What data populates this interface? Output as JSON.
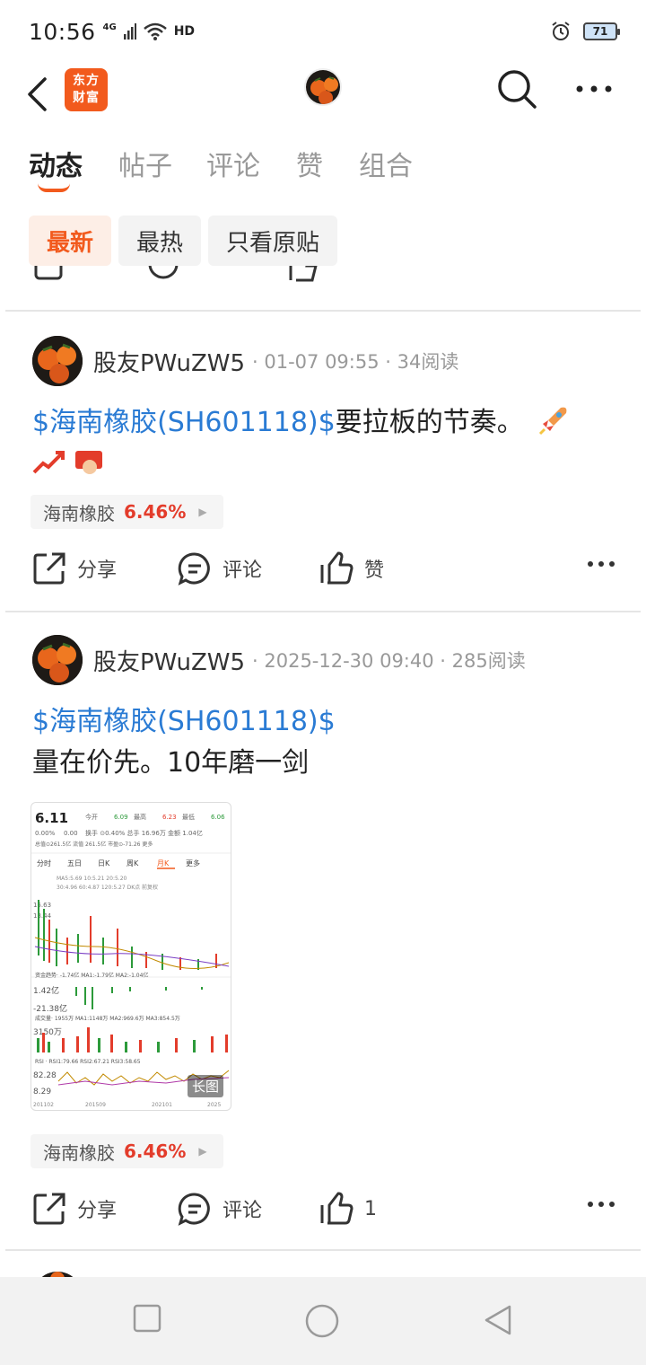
{
  "status_bar": {
    "time": "10:56",
    "network": "4G",
    "hd": "HD",
    "battery": "71"
  },
  "nav": {
    "brand_line1": "东方",
    "brand_line2": "财富"
  },
  "tabs": [
    "动态",
    "帖子",
    "评论",
    "赞",
    "组合"
  ],
  "filters": [
    "最新",
    "最热",
    "只看原贴"
  ],
  "posts": [
    {
      "username": "股友PWuZW5",
      "meta": "· 01-07 09:55 · 34阅读",
      "stock_link": "$海南橡胶(SH601118)$",
      "text": "要拉板的节奏。",
      "tag_name": "海南橡胶",
      "tag_pct": "6.46%",
      "share": "分享",
      "comment": "评论",
      "like": "赞"
    },
    {
      "username": "股友PWuZW5",
      "meta": "· 2025-12-30 09:40 · 285阅读",
      "stock_link": "$海南橡胶(SH601118)$",
      "text": "量在价先。10年磨一剑",
      "tag_name": "海南橡胶",
      "tag_pct": "6.46%",
      "share": "分享",
      "comment": "评论",
      "like": "1",
      "image_badge": "长图",
      "chart": {
        "price": "6.11",
        "change": "0.00%",
        "change_abs": "0.00",
        "open_label": "今开",
        "open": "6.09",
        "high_label": "最高",
        "high": "6.23",
        "low_label": "最低",
        "low": "6.06",
        "row2": "换手 ⊙0.40%  总手 16.96万  金额 1.04亿",
        "row3": "总值⊙261.5亿  流值 261.5亿  市盈⊙-71.26  更多",
        "periods": [
          "分时",
          "五日",
          "日K",
          "周K",
          "月K",
          "更多"
        ],
        "ma_row": "MA5:5.69  10:5.21  20:5.20",
        "ma_row2": "30:4.96  60:4.87  120:5.27  DK点  前复权",
        "y1": "15.63",
        "y2": "13.44",
        "y3": "1.42亿",
        "y4": "-21.38亿",
        "fund_label": "资金趋势· -1.74亿  MA1:-1.79亿  MA2:-1.04亿",
        "vol_label": "成交量· 1955万  MA1:1148万  MA2:969.6万  MA3:854.5万",
        "vol_val": "3150万",
        "rsi_label": "RSI · RSI1:79.66  RSI2:67.21  RSI3:58.65",
        "rsi_top": "82.28",
        "rsi_bot": "8.29",
        "x_labels": [
          "201102",
          "201509",
          "202101",
          "2025"
        ]
      }
    }
  ],
  "colors": {
    "accent": "#f25a1d",
    "link": "#2a7bd4",
    "up": "#e33c2b"
  }
}
